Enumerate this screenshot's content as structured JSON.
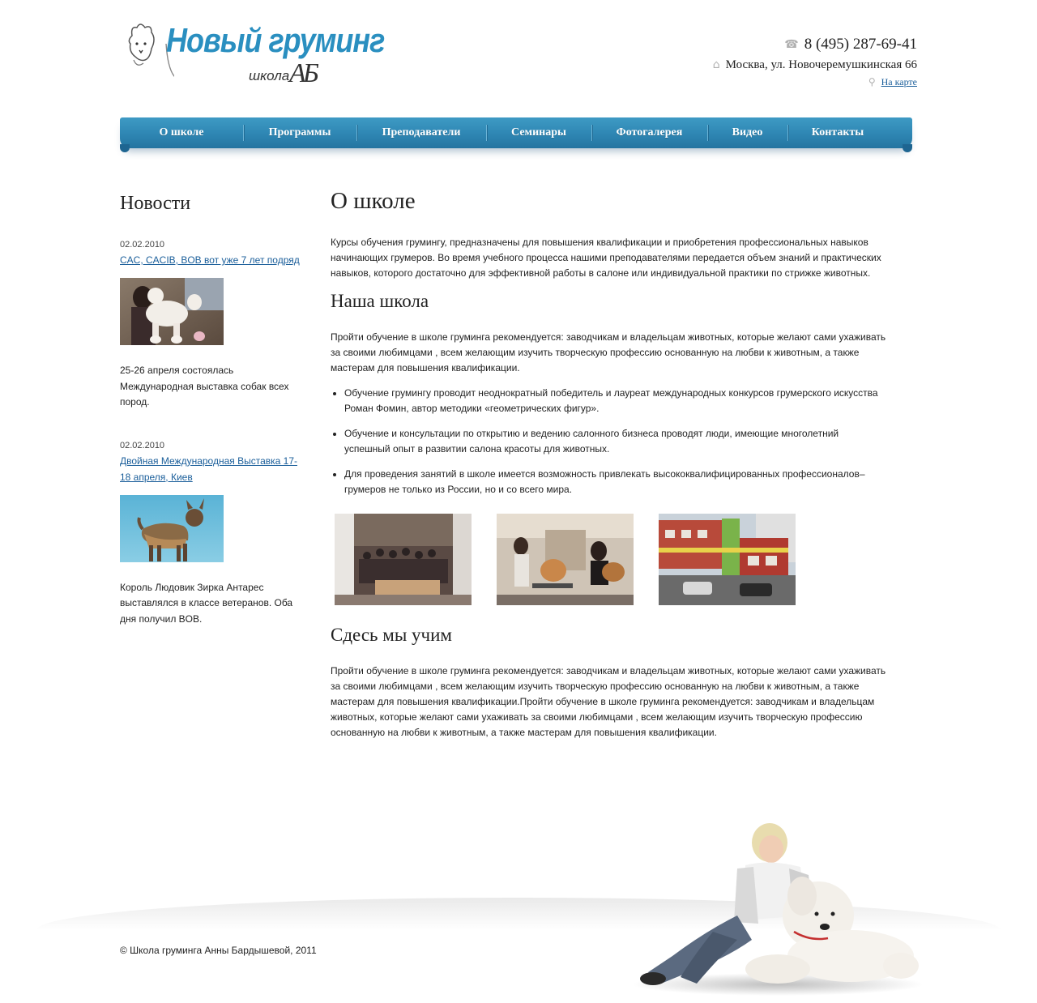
{
  "header": {
    "logo_title": "Новый груминг",
    "logo_sub": "школа",
    "logo_mono": "АБ",
    "phone": "8 (495) 287-69-41",
    "address": "Москва, ул. Новочеремушкинская 66",
    "map_link": "На карте",
    "icons": [
      "phone-icon",
      "home-icon",
      "map-pin-icon"
    ]
  },
  "nav": {
    "items": [
      {
        "label": "О школе"
      },
      {
        "label": "Программы"
      },
      {
        "label": "Преподаватели"
      },
      {
        "label": "Семинары"
      },
      {
        "label": "Фотогалерея"
      },
      {
        "label": "Видео"
      },
      {
        "label": "Контакты"
      }
    ]
  },
  "sidebar": {
    "title": "Новости",
    "news": [
      {
        "date": "02.02.2010",
        "title": "CAC, CACIB, BOB вот уже 7 лет подряд",
        "text": "25-26 апреля состоялась Международная выставка собак всех пород."
      },
      {
        "date": "02.02.2010",
        "title": "Двойная Международная Выставка 17-18 апреля, Киев",
        "text": "Король Людовик Зирка Антарес выставлялся в классе ветеранов. Оба дня получил BOB."
      }
    ]
  },
  "main": {
    "title": "О школе",
    "intro": "Курсы обучения грумингу, предназначены для повышения квалификации и приобретения профессиональных навыков начинающих грумеров. Во время учебного процесса нашими преподавателями передается объем знаний и практических навыков, которого достаточно для эффективной работы в салоне или индивидуальной практики по стрижке животных.",
    "school_title": "Наша школа",
    "school_text": "Пройти обучение в школе груминга рекомендуется: заводчикам и владельцам животных, которые желают сами ухаживать за своими любимцами , всем желающим изучить творческую профессию основанную на любви к животным, а также мастерам для повышения квалификации.",
    "bullets": [
      "Обучение грумингу проводит неоднократный победитель и лауреат международных конкурсов грумерского искусства Роман Фомин, автор методики «геометрических фигур».",
      "Обучение и консультации по открытию и ведению салонного бизнеса проводят люди, имеющие многолетний успешный опыт в развитии салона красоты для животных.",
      "Для проведения занятий в школе имеется возможность привлекать высококвалифицированных профессионалов– грумеров не только из России, но и со всего мира."
    ],
    "teach_title": "Сдесь мы учим",
    "teach_text": "Пройти обучение в школе груминга рекомендуется: заводчикам и владельцам животных, которые желают сами ухаживать за своими любимцами , всем желающим изучить творческую профессию основанную на любви к животным, а также мастерам для повышения квалификации.Пройти обучение в школе груминга рекомендуется: заводчикам и владельцам животных, которые желают сами ухаживать за своими любимцами , всем желающим изучить творческую профессию основанную на любви к животным, а также мастерам для повышения квалификации."
  },
  "footer": {
    "copyright": "© Школа груминга Анны Бардышевой, 2011"
  },
  "colors": {
    "nav": "#2e86b3",
    "link": "#1a5e9a",
    "logo": "#2a8fc0"
  }
}
